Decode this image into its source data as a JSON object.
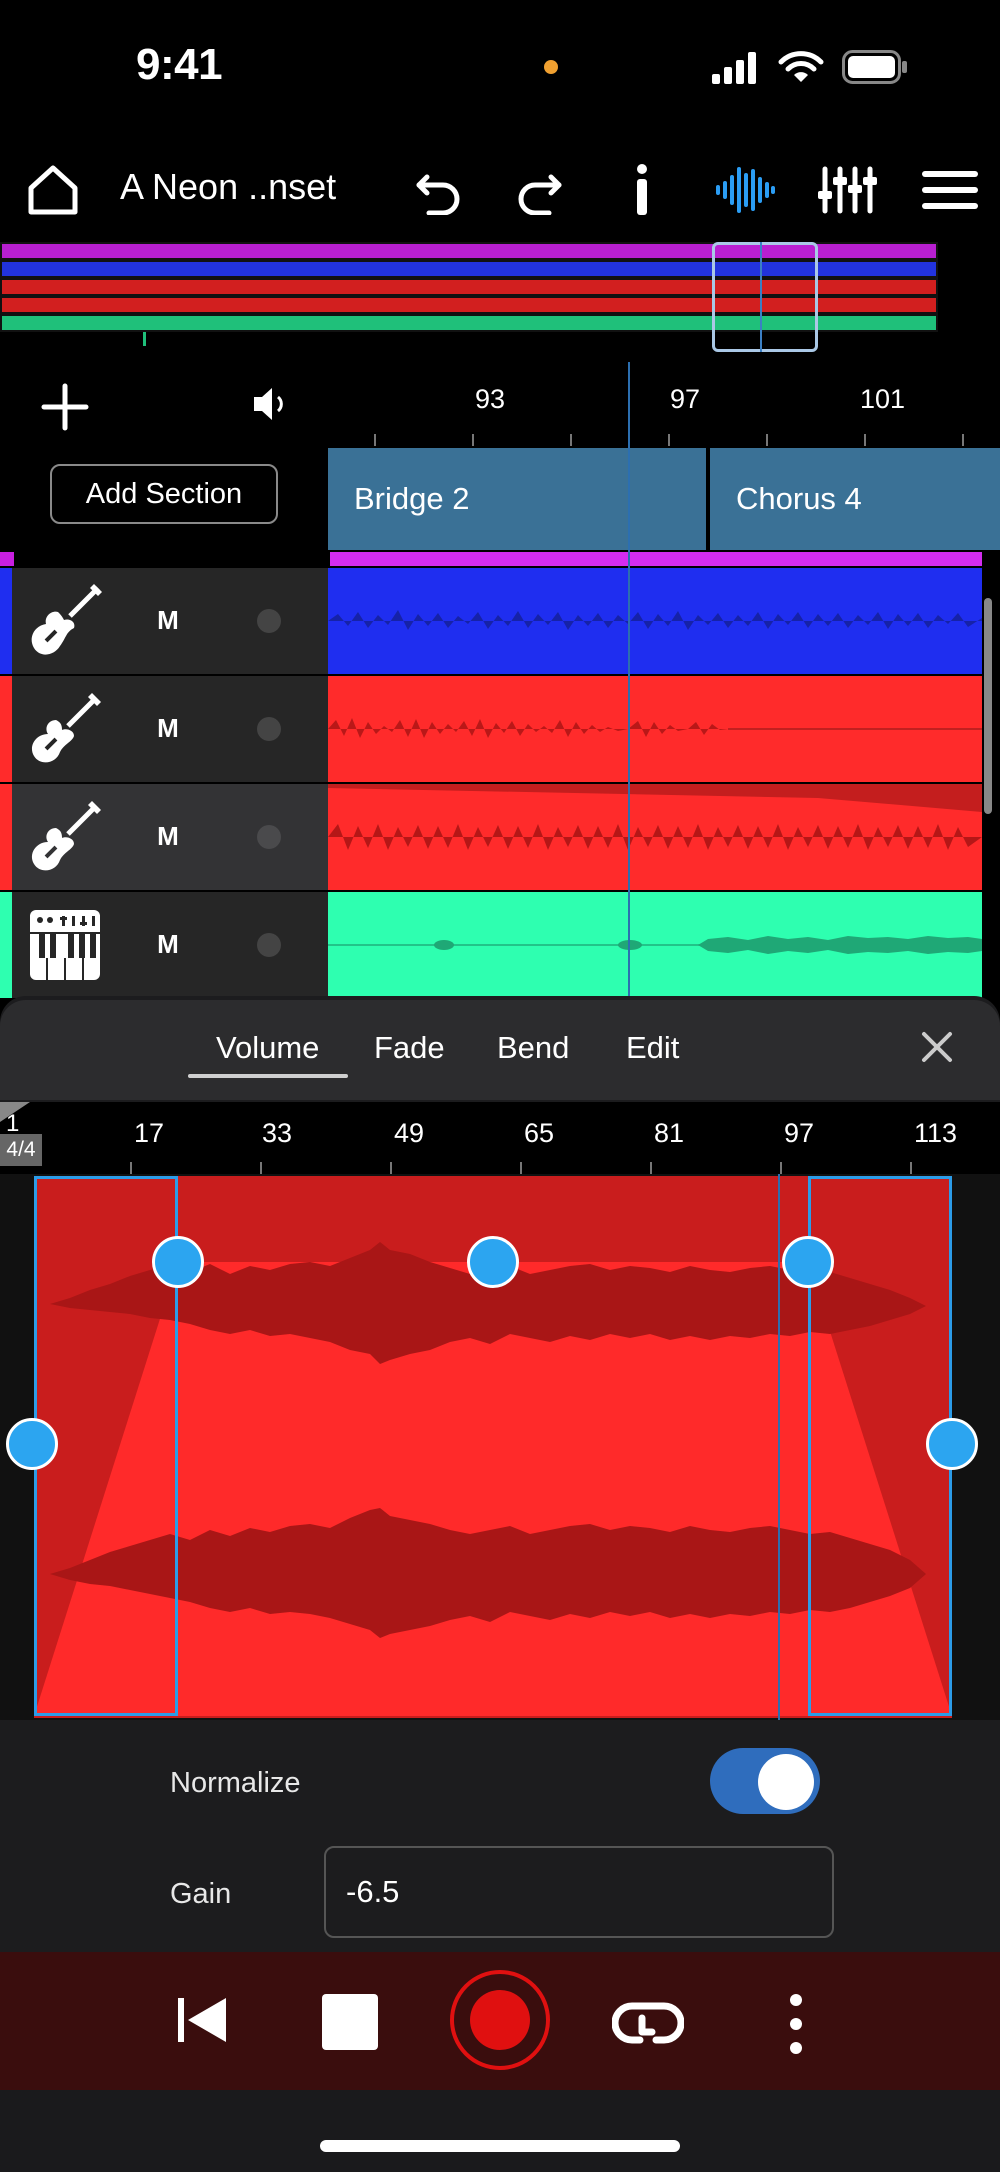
{
  "status": {
    "time": "9:41"
  },
  "toolbar": {
    "project_title": "A Neon ..nset",
    "icons": [
      "home-icon",
      "undo-icon",
      "redo-icon",
      "info-icon",
      "waveform-icon",
      "mixer-icon",
      "menu-icon"
    ],
    "active_color": "#2b9df4"
  },
  "overview": {
    "bar_colors": [
      "#b81fd0",
      "#2233dd",
      "#d21f1f",
      "#d21f1f",
      "#1fc07a"
    ]
  },
  "track_controls": {
    "add_section_label": "Add Section"
  },
  "timeline": {
    "bar_labels": [
      "93",
      "97",
      "101"
    ],
    "sections": [
      "Bridge 2",
      "Chorus 4"
    ]
  },
  "tracks": [
    {
      "instrument": "bass-guitar-icon",
      "mute_label": "M",
      "color": "#1f2ef0"
    },
    {
      "instrument": "electric-guitar-icon",
      "mute_label": "M",
      "color": "#ff2b2b"
    },
    {
      "instrument": "electric-guitar-icon",
      "mute_label": "M",
      "color": "#ff2b2b"
    },
    {
      "instrument": "keyboard-icon",
      "mute_label": "M",
      "color": "#2effb0"
    }
  ],
  "editor": {
    "tabs": [
      "Volume",
      "Fade",
      "Bend",
      "Edit"
    ],
    "active_tab": "Volume",
    "time_signature": "4/4",
    "ruler_labels": [
      "1",
      "17",
      "33",
      "49",
      "65",
      "81",
      "97",
      "113"
    ],
    "normalize_label": "Normalize",
    "normalize_on": true,
    "gain_label": "Gain",
    "gain_value": "-6.5"
  },
  "transport": {
    "buttons": [
      "rewind-icon",
      "stop-icon",
      "record-icon",
      "loop-icon",
      "more-icon"
    ],
    "record_color": "#e01010"
  }
}
